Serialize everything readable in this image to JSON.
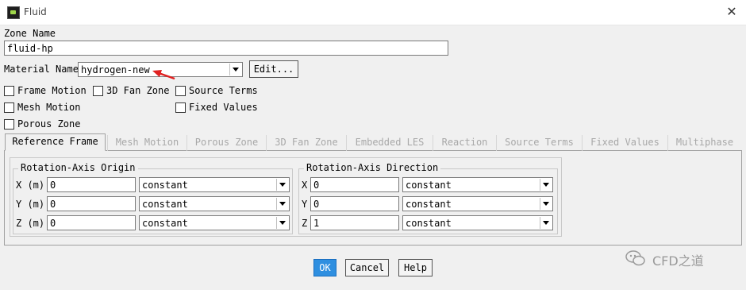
{
  "window": {
    "title": "Fluid",
    "close_glyph": "✕"
  },
  "zone": {
    "label": "Zone Name",
    "value": "fluid-hp"
  },
  "material": {
    "label": "Material Name",
    "value": "hydrogen-new",
    "edit_label": "Edit..."
  },
  "checkboxes": [
    {
      "label": "Frame Motion",
      "checked": false
    },
    {
      "label": "3D Fan Zone",
      "checked": false
    },
    {
      "label": "Source Terms",
      "checked": false
    },
    {
      "label": "Mesh Motion",
      "checked": false
    },
    {
      "label": "Fixed Values",
      "checked": false
    },
    {
      "label": "Porous Zone",
      "checked": false
    }
  ],
  "tabs": [
    {
      "label": "Reference Frame",
      "active": true
    },
    {
      "label": "Mesh Motion",
      "active": false
    },
    {
      "label": "Porous Zone",
      "active": false
    },
    {
      "label": "3D Fan Zone",
      "active": false
    },
    {
      "label": "Embedded LES",
      "active": false
    },
    {
      "label": "Reaction",
      "active": false
    },
    {
      "label": "Source Terms",
      "active": false
    },
    {
      "label": "Fixed Values",
      "active": false
    },
    {
      "label": "Multiphase",
      "active": false
    }
  ],
  "origin": {
    "title": "Rotation-Axis Origin",
    "rows": [
      {
        "label": "X (m)",
        "value": "0",
        "method": "constant"
      },
      {
        "label": "Y (m)",
        "value": "0",
        "method": "constant"
      },
      {
        "label": "Z (m)",
        "value": "0",
        "method": "constant"
      }
    ]
  },
  "direction": {
    "title": "Rotation-Axis Direction",
    "rows": [
      {
        "label": "X",
        "value": "0",
        "method": "constant"
      },
      {
        "label": "Y",
        "value": "0",
        "method": "constant"
      },
      {
        "label": "Z",
        "value": "1",
        "method": "constant"
      }
    ]
  },
  "buttons": {
    "ok": "OK",
    "cancel": "Cancel",
    "help": "Help"
  },
  "watermark": {
    "text": "CFD之道"
  },
  "colors": {
    "ok_button": "#2f8fe0",
    "annotation_arrow": "#e02020"
  }
}
